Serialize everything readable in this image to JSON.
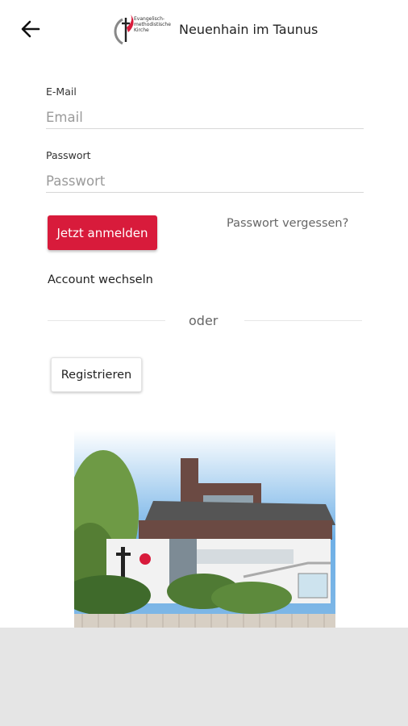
{
  "header": {
    "title": "Neuenhain im Taunus",
    "logo_text": [
      "Evangelisch-",
      "methodistische",
      "Kirche"
    ]
  },
  "form": {
    "email_label": "E-Mail",
    "email_placeholder": "Email",
    "password_label": "Passwort",
    "password_placeholder": "Passwort",
    "login_button": "Jetzt anmelden",
    "forgot_password": "Passwort vergessen?",
    "switch_account": "Account wechseln",
    "divider_text": "oder",
    "register_button": "Registrieren"
  },
  "colors": {
    "accent": "#d81b3b",
    "bottom_panel": "#e5e5e5"
  },
  "icons": {
    "back": "arrow-left-icon",
    "logo": "church-logo-icon"
  }
}
